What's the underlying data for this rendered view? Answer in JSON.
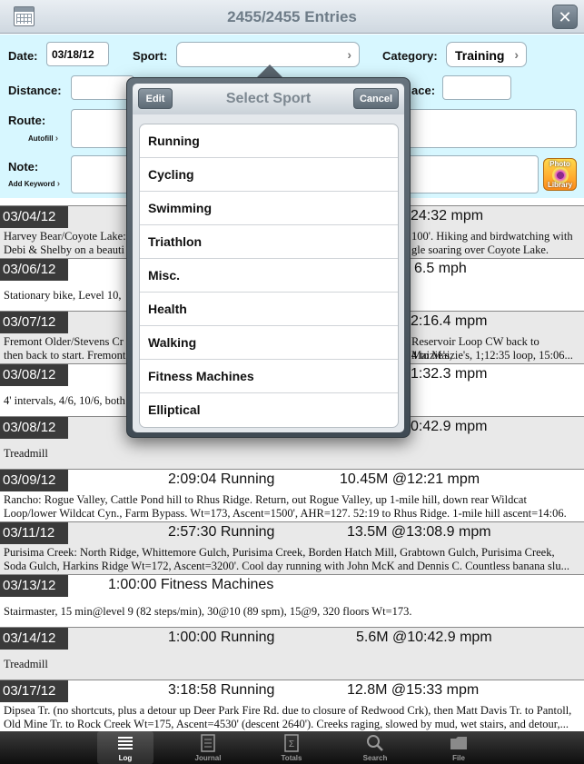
{
  "header": {
    "title": "2455/2455 Entries",
    "close_label": "✕"
  },
  "form": {
    "date_label": "Date:",
    "date_value": "03/18/12",
    "sport_label": "Sport:",
    "sport_value": "",
    "category_label": "Category:",
    "category_value": "Training",
    "distance_label": "Distance:",
    "pace_label_fragment": "ace:",
    "route_label": "Route:",
    "autofill_label": "Autofill",
    "note_label": "Note:",
    "add_keyword_label": "Add Keyword",
    "photo_library_line1": "Photo",
    "photo_library_line2": "Library"
  },
  "log": {
    "entries": [
      {
        "date": "03/04/12",
        "duration": "",
        "distance": "24:32 mpm",
        "desc_left": "Harvey Bear/Coyote Lake:",
        "desc_right": "100'. Hiking and birdwatching with",
        "desc2_left": "Debi & Shelby on a beauti",
        "desc2_right": "gle soaring over Coyote Lake."
      },
      {
        "date": "03/06/12",
        "duration": "",
        "distance": "6.5 mph",
        "desc_left": "Stationary bike, Level 10, ",
        "desc_right": ""
      },
      {
        "date": "03/07/12",
        "duration": "",
        "distance": "2:16.4 mpm",
        "desc_left": "Fremont Older/Stevens Cr",
        "desc_right": "Reservoir Loop CW back to Maizie's,",
        "desc2_left": "then back to start. Fremont",
        "desc2_right": "4 to Maizie's, 1;12:35 loop, 15:06..."
      },
      {
        "date": "03/08/12",
        "duration": "",
        "distance": "1:32.3 mpm",
        "desc_left": "4' intervals, 4/6, 10/6, both",
        "desc_right": ""
      },
      {
        "date": "03/08/12",
        "duration": "",
        "distance": "0:42.9 mpm",
        "desc_left": "Treadmill",
        "desc_right": ""
      },
      {
        "date": "03/09/12",
        "duration": "2:09:04 Running",
        "distance": "10.45M @12:21 mpm",
        "desc": "Rancho: Rogue Valley, Cattle Pond hill to Rhus Ridge. Return, out Rogue Valley, up 1-mile hill, down rear Wildcat Loop/lower Wildcat Cyn., Farm Bypass. Wt=173, Ascent=1500', AHR=127. 52:19 to Rhus Ridge. 1-mile hill ascent=14:06."
      },
      {
        "date": "03/11/12",
        "duration": "2:57:30 Running",
        "distance": "13.5M @13:08.9 mpm",
        "desc": "Purisima Creek: North Ridge, Whittemore Gulch, Purisima Creek, Borden Hatch Mill, Grabtown Gulch, Purisima Creek, Soda Gulch, Harkins Ridge Wt=172, Ascent=3200'. Cool day running with John McK and Dennis C. Countless banana slu..."
      },
      {
        "date": "03/13/12",
        "duration": "1:00:00 Fitness Machines",
        "distance": "",
        "desc": "Stairmaster, 15 min@level 9 (82 steps/min), 30@10 (89 spm), 15@9, 320 floors Wt=173."
      },
      {
        "date": "03/14/12",
        "duration": "1:00:00 Running",
        "distance": "5.6M @10:42.9 mpm",
        "desc": "Treadmill"
      },
      {
        "date": "03/17/12",
        "duration": "3:18:58 Running",
        "distance": "12.8M @15:33 mpm",
        "desc": "Dipsea Tr. (no shortcuts, plus a detour up Deer Park Fire Rd. due to closure of Redwood Crk), then Matt Davis Tr. to Pantoll, Old Mine Tr. to Rock Creek Wt=175, Ascent=4530' (descent 2640'). Creeks raging, slowed by mud, wet stairs, and detour,..."
      }
    ]
  },
  "popover": {
    "title": "Select Sport",
    "edit_label": "Edit",
    "cancel_label": "Cancel",
    "items": [
      "Running",
      "Cycling",
      "Swimming",
      "Triathlon",
      "Misc.",
      "Health",
      "Walking",
      "Fitness Machines",
      "Elliptical"
    ]
  },
  "tabbar": {
    "tabs": [
      "Log",
      "Journal",
      "Totals",
      "Search",
      "File"
    ],
    "active": "Log"
  }
}
